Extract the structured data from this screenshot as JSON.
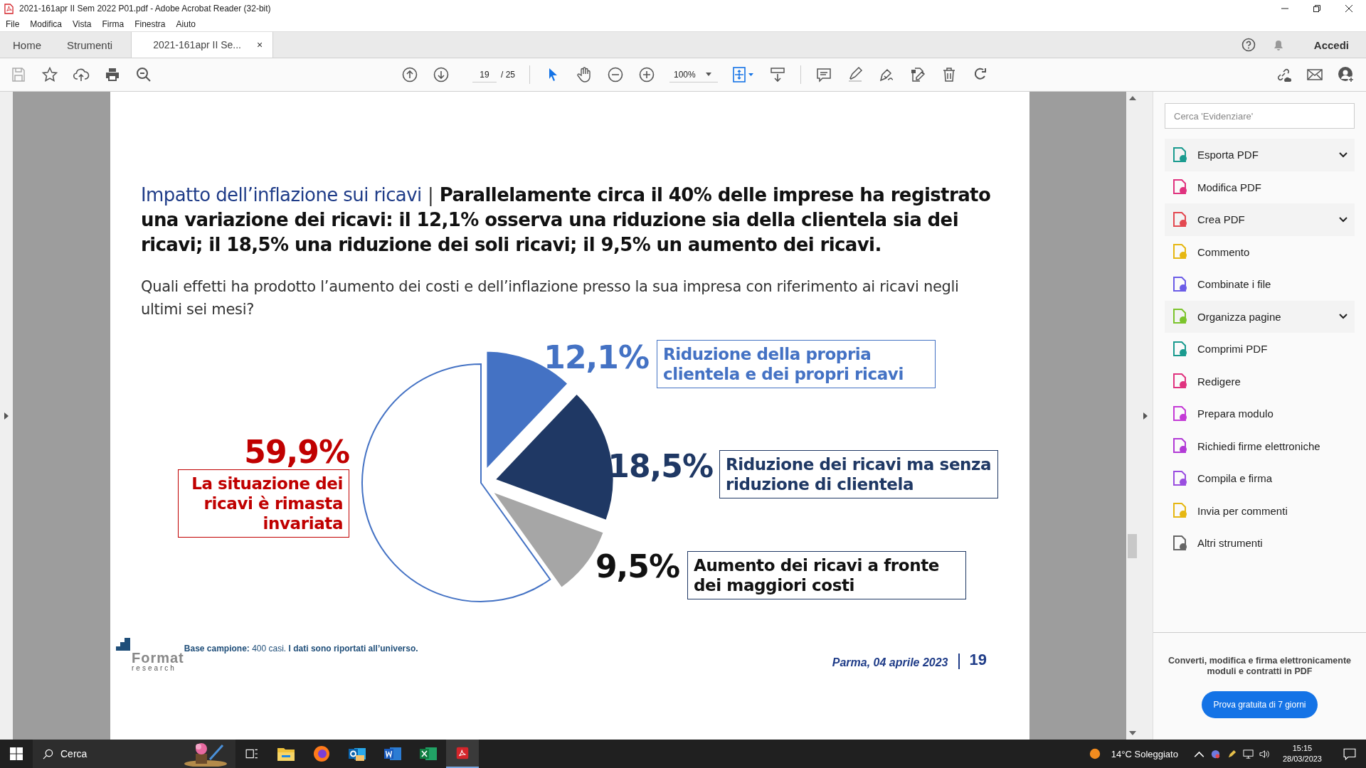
{
  "window": {
    "title": "2021-161apr II Sem 2022 P01.pdf - Adobe Acrobat Reader (32-bit)"
  },
  "menu": [
    "File",
    "Modifica",
    "Vista",
    "Firma",
    "Finestra",
    "Aiuto"
  ],
  "tabs": [
    {
      "label": "Home",
      "selected": false
    },
    {
      "label": "Strumenti",
      "selected": false
    },
    {
      "label": "2021-161apr II Se...",
      "selected": true,
      "close": "×"
    }
  ],
  "account": {
    "label": "Accedi"
  },
  "toolbar": {
    "page": "19",
    "total": "/ 25",
    "zoom": "100%"
  },
  "slide": {
    "topic": "Impatto dell’inflazione sui ricavi",
    "separator": "|",
    "headline": "Parallelamente circa il 40% delle imprese ha registrato una variazione dei ricavi: il 12,1% osserva una riduzione sia della clientela sia dei ricavi; il 18,5% una riduzione dei soli ricavi; il 9,5% un aumento dei ricavi.",
    "question": "Quali effetti ha prodotto l’aumento dei costi e dell’inflazione presso la sua impresa con riferimento ai ricavi negli ultimi sei mesi?",
    "chart_data": {
      "type": "pie",
      "categories": [
        "Riduzione della propria clientela e dei propri ricavi",
        "Riduzione dei ricavi ma senza riduzione di clientela",
        "Aumento dei ricavi a fronte dei maggiori costi",
        "La situazione dei ricavi è rimasta invariata"
      ],
      "values": [
        12.1,
        18.5,
        9.5,
        59.9
      ],
      "value_labels": [
        "12,1%",
        "18,5%",
        "9,5%",
        "59,9%"
      ],
      "colors": [
        "#4472c4",
        "#1f3864",
        "#a6a6a6",
        "#ffffff"
      ]
    },
    "footnote": "**Base campione:** 400 casi. **I dati sono riportati all’universo.**",
    "logo": {
      "name": "Format",
      "sub": "research"
    },
    "place_date": "Parma,  04 aprile 2023",
    "page_number": "19"
  },
  "tools_panel": {
    "search": {
      "placeholder": "Cerca 'Evidenziare'"
    },
    "items": [
      {
        "label": "Esporta PDF",
        "expandable": true,
        "color": "#1a9b8f"
      },
      {
        "label": "Modifica PDF",
        "expandable": false,
        "color": "#e0337f"
      },
      {
        "label": "Crea PDF",
        "expandable": true,
        "color": "#e34850"
      },
      {
        "label": "Commento",
        "expandable": false,
        "color": "#e6b712"
      },
      {
        "label": "Combinate i file",
        "expandable": false,
        "color": "#6b5ce7"
      },
      {
        "label": "Organizza pagine",
        "expandable": true,
        "color": "#7cc42c"
      },
      {
        "label": "Comprimi PDF",
        "expandable": false,
        "color": "#1a9b8f"
      },
      {
        "label": "Redigere",
        "expandable": false,
        "color": "#e0337f"
      },
      {
        "label": "Prepara modulo",
        "expandable": false,
        "color": "#c43ad6"
      },
      {
        "label": "Richiedi firme elettroniche",
        "expandable": false,
        "color": "#b23ad6"
      },
      {
        "label": "Compila e firma",
        "expandable": false,
        "color": "#9a4ee0"
      },
      {
        "label": "Invia per commenti",
        "expandable": false,
        "color": "#e6b712"
      },
      {
        "label": "Altri strumenti",
        "expandable": false,
        "color": "#666666"
      }
    ],
    "promo": "Converti, modifica e firma elettronicamente moduli e contratti in PDF",
    "trial_button": "Prova gratuita di 7 giorni"
  },
  "taskbar": {
    "search": "Cerca",
    "weather": "14°C  Soleggiato",
    "time": "15:15",
    "date": "28/03/2023"
  }
}
